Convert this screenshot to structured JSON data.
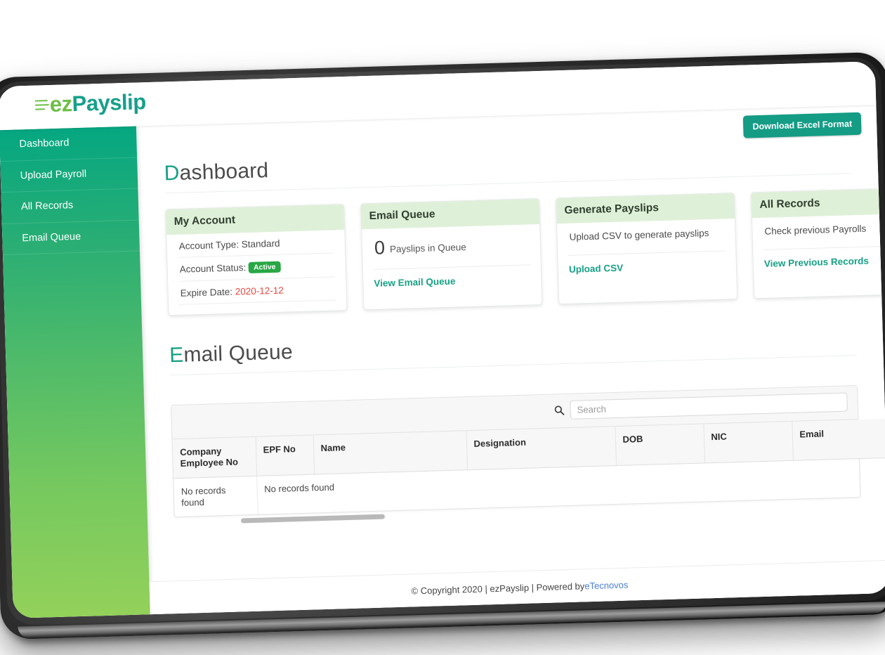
{
  "brand": {
    "logo_ez": "ez",
    "logo_payslip": "Payslip",
    "accent_teal": "#16a085",
    "accent_green": "#6cbf46"
  },
  "sidebar": {
    "items": [
      {
        "label": "Dashboard"
      },
      {
        "label": "Upload Payroll"
      },
      {
        "label": "All Records"
      },
      {
        "label": "Email Queue"
      }
    ]
  },
  "toolbar": {
    "download_excel_label": "Download Excel Format"
  },
  "page": {
    "title_first": "D",
    "title_rest": "ashboard"
  },
  "cards": [
    {
      "title": "My Account",
      "rows": [
        {
          "label": "Account Type: ",
          "value": "Standard",
          "kind": "text"
        },
        {
          "label": "Account Status: ",
          "value": "Active",
          "kind": "badge"
        },
        {
          "label": "Expire Date: ",
          "value": "2020-12-12",
          "kind": "red"
        }
      ]
    },
    {
      "title": "Email Queue",
      "metric_number": "0",
      "metric_label": "Payslips in Queue",
      "link": "View Email Queue"
    },
    {
      "title": "Generate Payslips",
      "description": "Upload CSV to generate payslips",
      "link": "Upload CSV"
    },
    {
      "title": "All Records",
      "description": "Check previous Payrolls",
      "link": "View Previous Records"
    }
  ],
  "section": {
    "title_first": "E",
    "title_rest": "mail Queue"
  },
  "search": {
    "placeholder": "Search",
    "value": "",
    "icon": "search-icon"
  },
  "table": {
    "columns": [
      "Company Employee No",
      "EPF No",
      "Name",
      "Designation",
      "DOB",
      "NIC",
      "Email"
    ],
    "rows": [
      [
        "No records found",
        "No records found",
        "",
        "",
        "",
        "",
        ""
      ]
    ]
  },
  "footer": {
    "text_before": "© Copyright 2020 | ezPayslip | Powered by ",
    "link": "eTecnovos"
  }
}
